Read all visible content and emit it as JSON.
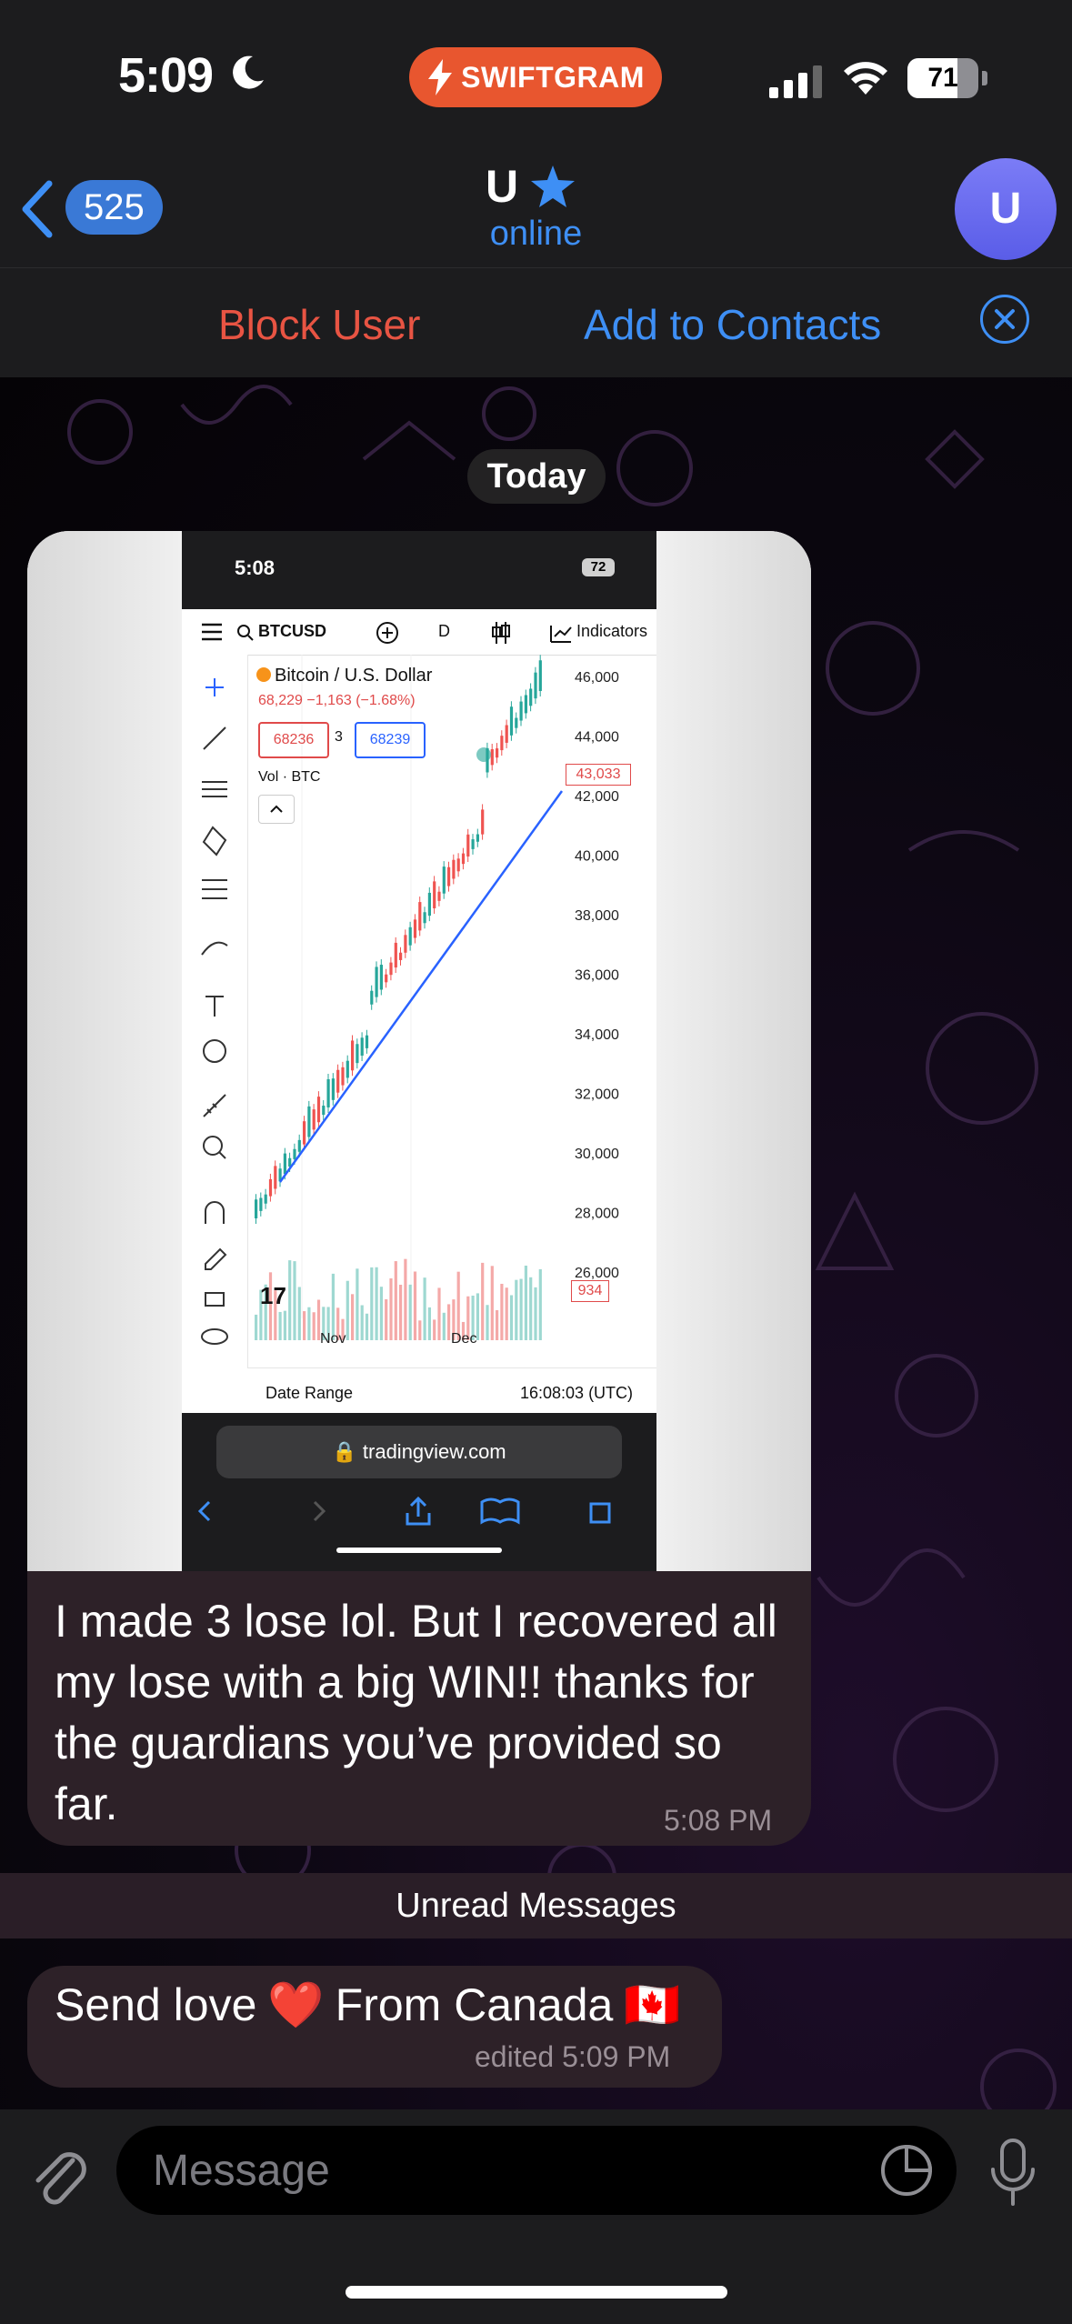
{
  "status_bar": {
    "time": "5:09",
    "badge": "SWIFTGRAM",
    "battery": "71",
    "battery_level": 0.71
  },
  "header": {
    "back_count": "525",
    "title": "U",
    "status": "online",
    "avatar_letter": "U"
  },
  "actions": {
    "block": "Block User",
    "add": "Add to Contacts"
  },
  "chat": {
    "date": "Today",
    "photo": {
      "status_time": "5:08",
      "battery": "72",
      "symbol": "BTCUSD",
      "interval": "D",
      "indicators": "Indicators",
      "title": "Bitcoin / U.S. Dollar",
      "price_line": "68,229 −1,163 (−1.68%)",
      "bid": "68236",
      "spread": "3",
      "ask": "68239",
      "vol": "Vol · BTC",
      "date_range": "Date Range",
      "utc": "16:08:03 (UTC)",
      "url": "tradingview.com",
      "y_labels": [
        "46,000",
        "44,000",
        "42,000",
        "40,000",
        "38,000",
        "36,000",
        "34,000",
        "32,000",
        "30,000",
        "28,000",
        "26,000"
      ],
      "last_price_tag": "43,033",
      "vol_tag": "934",
      "x_labels": [
        "Nov",
        "Dec"
      ]
    },
    "message1": "I made 3 lose lol. But I recovered all my lose with a big WIN!! thanks for the guardians you’ve provided so far.",
    "message1_time": "5:08 PM",
    "unread_label": "Unread Messages",
    "message2_text": "Send love",
    "message2_heart": "❤️",
    "message2_text2": "From Canada",
    "message2_flag": "🇨🇦",
    "message2_time": "edited 5:09 PM"
  },
  "input": {
    "placeholder": "Message"
  },
  "colors": {
    "accent": "#3e8ff5",
    "danger": "#e85443",
    "badge": "#e8562f",
    "bubble": "#2d2128"
  }
}
